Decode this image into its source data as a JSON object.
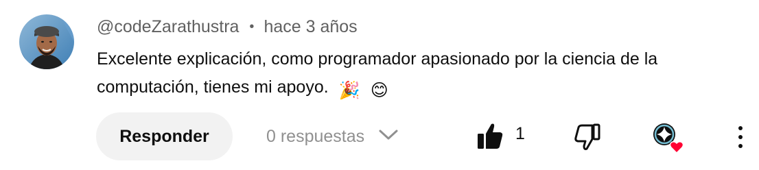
{
  "comment": {
    "author": "@codeZarathustra",
    "separator": "•",
    "time": "hace 3 años",
    "text": "Excelente explicación, como programador apasionado por la ciencia de la computación, tienes mi apoyo.",
    "emojis": [
      "🎉",
      "😊"
    ]
  },
  "actions": {
    "reply_label": "Responder",
    "replies_label": "0 respuestas",
    "like_count": "1"
  },
  "icons": {
    "avatar": "avatar",
    "replies_toggle": "chevron-down-icon",
    "like": "thumb-up-filled-icon",
    "dislike": "thumb-down-outline-icon",
    "creator_heart": "creator-heart-icon",
    "more": "more-vertical-icon"
  },
  "colors": {
    "text_primary": "#0f0f0f",
    "text_secondary": "#606060",
    "button_bg": "#f2f2f2",
    "heart": "#ff0033"
  }
}
